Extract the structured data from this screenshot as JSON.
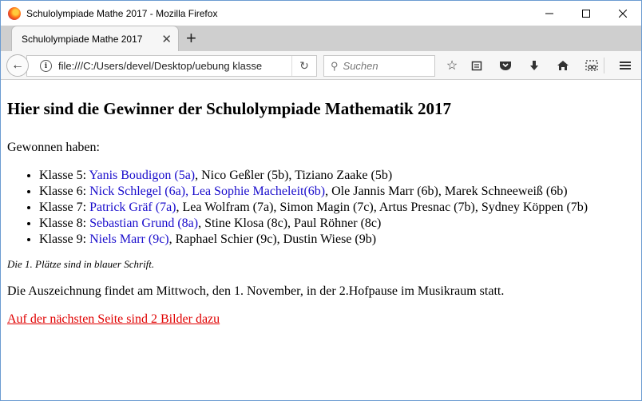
{
  "window": {
    "title": "Schulolympiade Mathe 2017 - Mozilla Firefox"
  },
  "tab": {
    "label": "Schulolympiade Mathe 2017"
  },
  "nav": {
    "url": "file:///C:/Users/devel/Desktop/uebung klasse",
    "search_placeholder": "Suchen"
  },
  "page": {
    "heading": "Hier sind die Gewinner der Schulolympiade Mathematik 2017",
    "intro": "Gewonnen haben:",
    "classes": [
      {
        "prefix": "Klasse 5: ",
        "winners": "Yanis Boudigon (5a)",
        "rest": ", Nico Geßler (5b), Tiziano Zaake (5b)"
      },
      {
        "prefix": "Klasse 6: ",
        "winners": "Nick Schlegel (6a), Lea Sophie Macheleit(6b)",
        "rest": ", Ole Jannis Marr (6b), Marek Schneeweiß (6b)"
      },
      {
        "prefix": "Klasse 7: ",
        "winners": "Patrick Gräf (7a)",
        "rest": ", Lea Wolfram (7a), Simon Magin (7c), Artus Presnac (7b), Sydney Köppen (7b)"
      },
      {
        "prefix": "Klasse 8: ",
        "winners": "Sebastian Grund (8a)",
        "rest": ", Stine Klosa (8c), Paul Röhner (8c)"
      },
      {
        "prefix": "Klasse 9: ",
        "winners": "Niels Marr (9c)",
        "rest": ", Raphael Schier (9c), Dustin Wiese (9b)"
      }
    ],
    "note": "Die 1. Plätze sind in blauer Schrift.",
    "announcement": "Die Auszeichnung findet am Mittwoch, den 1. November, in der 2.Hofpause im Musikraum statt.",
    "next_link": "Auf der nächsten Seite sind 2 Bilder dazu"
  },
  "colors": {
    "winner_blue": "#1a0dcc",
    "link_red": "#e00000"
  }
}
